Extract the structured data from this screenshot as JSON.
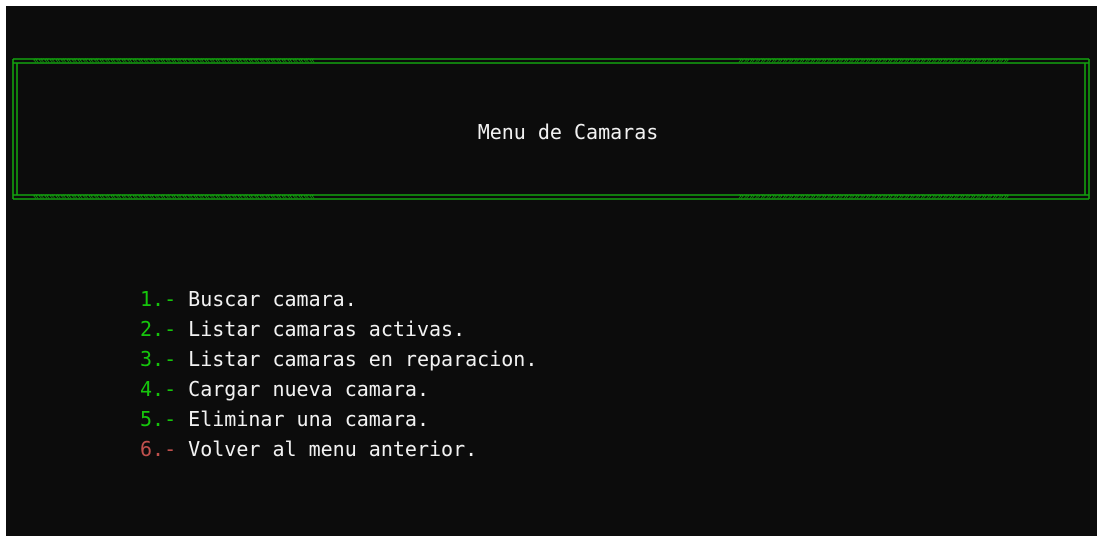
{
  "banner": {
    "title": "Menu de Camaras",
    "left_chevrons": "«««««««««««««««««««««««««««««««««««««««««««««««««««",
    "right_chevrons": "»»»»»»»»»»»»»»»»»»»»»»»»»»»»»»»»»»»»»»»»»»»»»»»»»",
    "border_color": "#13a10e"
  },
  "menu": {
    "items": [
      {
        "number": "1.-",
        "label": "Buscar camara."
      },
      {
        "number": "2.-",
        "label": "Listar camaras activas."
      },
      {
        "number": "3.-",
        "label": "Listar camaras en reparacion."
      },
      {
        "number": "4.-",
        "label": "Cargar nueva camara."
      },
      {
        "number": "5.-",
        "label": "Eliminar una camara."
      },
      {
        "number": "6.-",
        "label": "Volver al menu anterior."
      }
    ],
    "number_color": "#16c60c",
    "exit_number_color": "#c0504d",
    "text_color": "#f2f2f2"
  },
  "console": {
    "background": "#0c0c0c"
  }
}
